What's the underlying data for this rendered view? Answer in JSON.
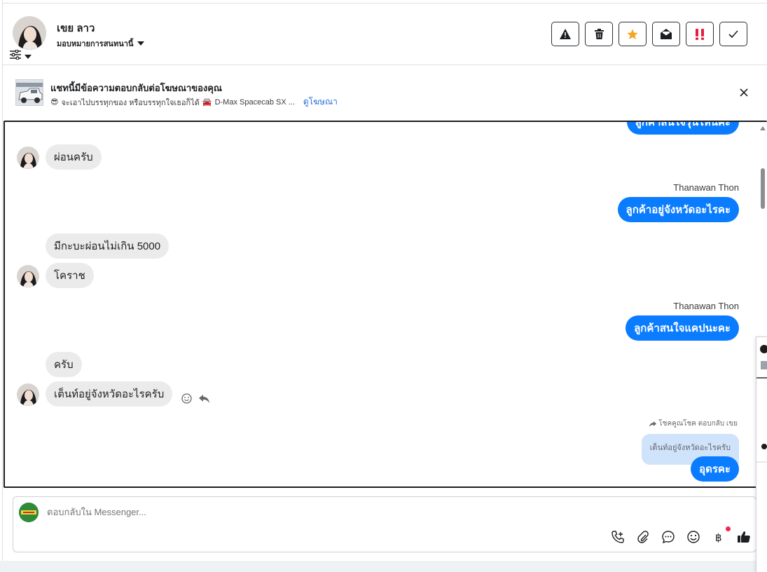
{
  "header": {
    "contact_name": "เขย ลาว",
    "assigned_label": "มอบหมายการสนทนานี้",
    "toolbar": [
      {
        "name": "report-spam-button",
        "icon": "warning-icon"
      },
      {
        "name": "delete-button",
        "icon": "trash-icon"
      },
      {
        "name": "star-button",
        "icon": "star-icon"
      },
      {
        "name": "mark-unread-button",
        "icon": "envelope-open-icon"
      },
      {
        "name": "follow-up-button",
        "icon": "exclamation-icon"
      },
      {
        "name": "mark-done-button",
        "icon": "check-icon"
      }
    ]
  },
  "ad": {
    "title": "แชทนี้มีข้อความตอบกลับต่อโฆษณาของคุณ",
    "emoji": "😎",
    "subtitle": "จะเอาไปบรรทุกของ หรือบรรทุกใจเธอก็ได้",
    "car_emoji": "🚘",
    "ad_name": "D-Max Spacecab SX ...",
    "link": "ดูโฆษณา"
  },
  "messages": {
    "top_partial": "ลูกค้าสนใจรุ่นไหนค่ะ",
    "m1": "ผ่อนครับ",
    "sender1": "Thanawan Thon",
    "m2": "ลูกค้าอยู่จังหวัดอะไรคะ",
    "m3": "มีกะบะผ่อนไม่เกิน 5000",
    "m4": "โคราช",
    "sender2": "Thanawan Thon",
    "m5": "ลูกค้าสนใจแคปนะคะ",
    "m6": "ครับ",
    "m7": "เต็นท์อยู่จังหวัดอะไรครับ",
    "reply_note": "โชคคูณโชค ตอบกลับ เขย",
    "quoted": "เต็นท์อยู่จังหวัดอะไรครับ",
    "m8": "อุดรคะ"
  },
  "composer": {
    "placeholder": "ตอบกลับใน Messenger...",
    "tools": [
      "phone-plus-icon",
      "paperclip-icon",
      "chat-bubble-icon",
      "smiley-icon",
      "baht-icon",
      "thumbs-up-icon"
    ]
  },
  "colors": {
    "accent": "#0a7cff",
    "incoming": "#ebebeb",
    "quoted": "#cfe3fb",
    "star": "#f5a623",
    "exclamation": "#e41e3f"
  }
}
